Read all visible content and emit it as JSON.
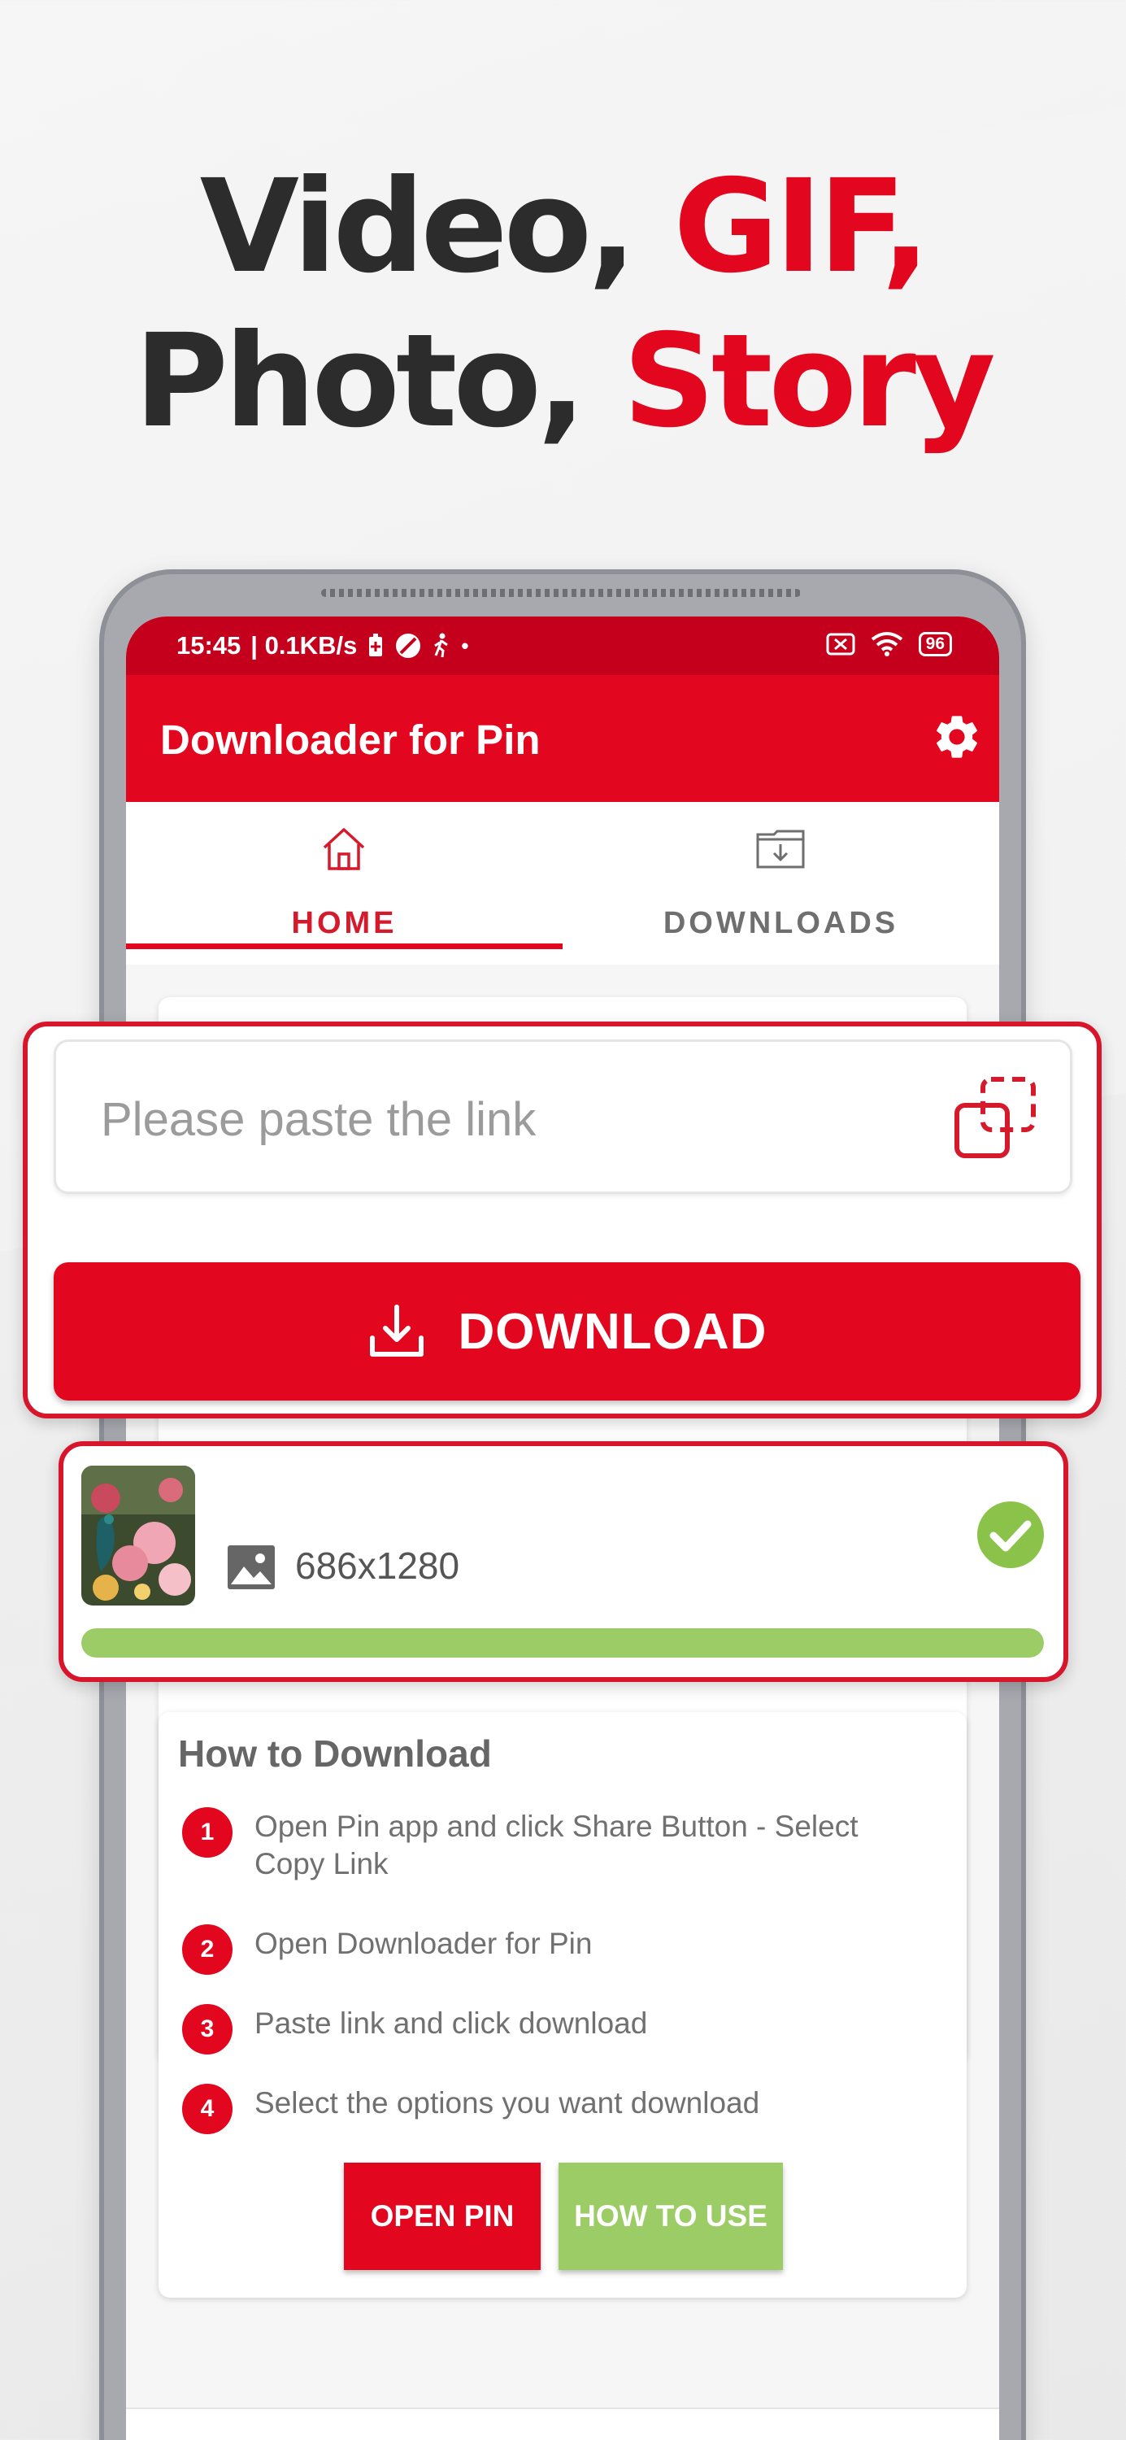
{
  "headline": {
    "line1_dark": "Video, ",
    "line1_red": "GIF,",
    "line2_dark": "Photo, ",
    "line2_red": "Story"
  },
  "statusbar": {
    "time": "15:45",
    "speed": "| 0.1KB/s",
    "battery": "96"
  },
  "appbar": {
    "title": "Downloader for Pin",
    "settings_icon": "gear-icon"
  },
  "tabs": [
    {
      "label": "HOME",
      "icon": "home-icon",
      "active": true
    },
    {
      "label": "DOWNLOADS",
      "icon": "folder-download-icon",
      "active": false
    }
  ],
  "link_input": {
    "placeholder": "Please paste the link",
    "value": ""
  },
  "download_button": {
    "label": "DOWNLOAD"
  },
  "download_item": {
    "dimensions": "686x1280",
    "progress": 1.0,
    "status": "completed"
  },
  "how_to": {
    "title": "How to Download",
    "steps": [
      {
        "num": "1",
        "text": "Open Pin app and click Share Button - Select Copy Link"
      },
      {
        "num": "2",
        "text": "Open Downloader for Pin"
      },
      {
        "num": "3",
        "text": "Paste link and click download"
      },
      {
        "num": "4",
        "text": "Select the options you want download"
      }
    ],
    "open_button": "OPEN PIN",
    "how_button": "HOW TO USE"
  },
  "colors": {
    "brand_red": "#e2061e",
    "accent_green": "#9ccc65",
    "status_dark_red": "#c4001c"
  }
}
